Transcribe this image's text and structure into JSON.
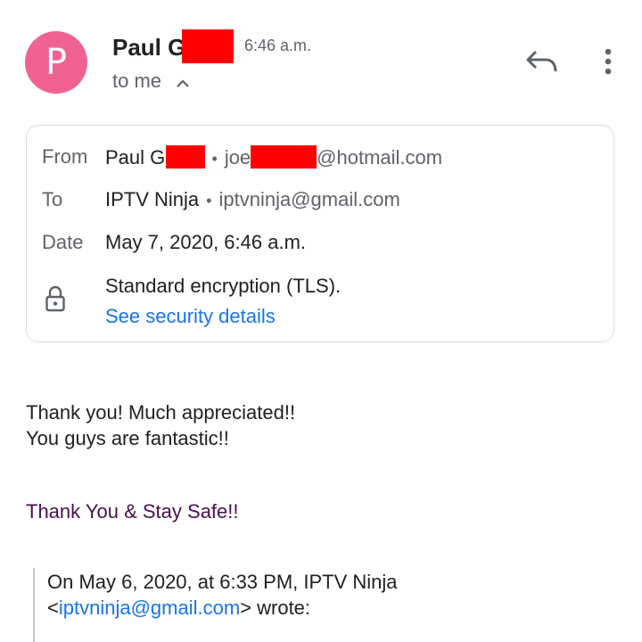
{
  "header": {
    "avatar_letter": "P",
    "avatar_color": "#f06292",
    "sender_name": "Paul G",
    "time": "6:46 a.m.",
    "recipient_summary": "to me"
  },
  "details": {
    "from_label": "From",
    "from_name": "Paul Ge",
    "from_email_prefix": "joe",
    "from_email_suffix": "@hotmail.com",
    "to_label": "To",
    "to_name": "IPTV Ninja",
    "to_email": "iptvninja@gmail.com",
    "date_label": "Date",
    "date_value": "May 7, 2020, 6:46 a.m.",
    "encryption_text": "Standard encryption (TLS).",
    "security_link": "See security details",
    "separator": "•"
  },
  "message": {
    "line1": "Thank you! Much appreciated!!",
    "line2": "You guys are fantastic!!",
    "signoff": "Thank You & Stay Safe!!"
  },
  "quote": {
    "line1": "On May 6, 2020, at 6:33 PM, IPTV Ninja",
    "open_bracket": "<",
    "email": "iptvninja@gmail.com",
    "tail": "> wrote:"
  },
  "icons": [
    "reply-icon",
    "more-vert-icon",
    "chevron-up-icon",
    "lock-icon"
  ],
  "colors": {
    "link": "#1a73e8",
    "redaction": "#ff0000",
    "signoff": "#4b0f52"
  }
}
